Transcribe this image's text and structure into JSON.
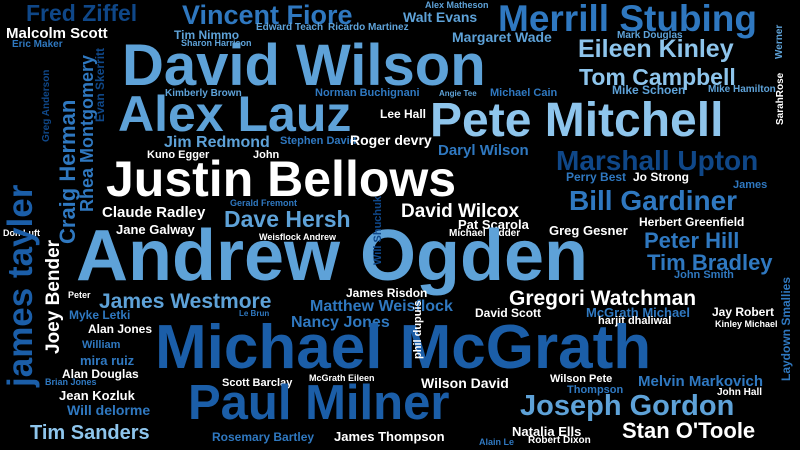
{
  "palette": {
    "background": "#000000",
    "white": "#ffffff",
    "sky": "#8ec5ec",
    "light": "#5ea2d8",
    "mid": "#2f78c0",
    "blue": "#1b5ea8",
    "deep": "#0f4788"
  },
  "words": [
    {
      "text": "Fred Ziffel",
      "color": "deep"
    },
    {
      "text": "Vincent Fiore",
      "color": "mid"
    },
    {
      "text": "Alex Matheson",
      "color": "light"
    },
    {
      "text": "Walt Evans",
      "color": "light"
    },
    {
      "text": "Merrill Stubing",
      "color": "mid"
    },
    {
      "text": "Malcolm Scott",
      "color": "white"
    },
    {
      "text": "Tim Nimmo",
      "color": "light"
    },
    {
      "text": "Edward Teach",
      "color": "light"
    },
    {
      "text": "Ricardo Martinez",
      "color": "light"
    },
    {
      "text": "Margaret Wade",
      "color": "light"
    },
    {
      "text": "Mark Douglas",
      "color": "light"
    },
    {
      "text": "Eric Maker",
      "color": "mid"
    },
    {
      "text": "Sharon Harrison",
      "color": "light"
    },
    {
      "text": "David Wilson",
      "color": "light"
    },
    {
      "text": "Eileen Kinley",
      "color": "sky"
    },
    {
      "text": "Werner",
      "color": "light"
    },
    {
      "text": "Tom Campbell",
      "color": "sky"
    },
    {
      "text": "SarahRose",
      "color": "white"
    },
    {
      "text": "Kimberly Brown",
      "color": "light"
    },
    {
      "text": "Norman Buchignani",
      "color": "mid"
    },
    {
      "text": "Angie Tee",
      "color": "light"
    },
    {
      "text": "Michael Cain",
      "color": "mid"
    },
    {
      "text": "Mike Schoen",
      "color": "light"
    },
    {
      "text": "Mike Hamilton",
      "color": "light"
    },
    {
      "text": "Alex Lauz",
      "color": "light"
    },
    {
      "text": "Lee Hall",
      "color": "white"
    },
    {
      "text": "Pete Mitchell",
      "color": "sky"
    },
    {
      "text": "Jim Redmond",
      "color": "light"
    },
    {
      "text": "Stephen David",
      "color": "mid"
    },
    {
      "text": "Roger devry",
      "color": "white"
    },
    {
      "text": "Daryl Wilson",
      "color": "mid"
    },
    {
      "text": "Kuno Egger",
      "color": "white"
    },
    {
      "text": "John",
      "color": "white"
    },
    {
      "text": "Marshall Upton",
      "color": "deep"
    },
    {
      "text": "Justin Bellows",
      "color": "white"
    },
    {
      "text": "Perry Best",
      "color": "mid"
    },
    {
      "text": "Jo Strong",
      "color": "white"
    },
    {
      "text": "James",
      "color": "mid"
    },
    {
      "text": "Gerald Fremont",
      "color": "mid"
    },
    {
      "text": "Bill Gardiner",
      "color": "mid"
    },
    {
      "text": "Claude Radley",
      "color": "white"
    },
    {
      "text": "Dave Hersh",
      "color": "light"
    },
    {
      "text": "David Wilcox",
      "color": "white"
    },
    {
      "text": "Pat Scarola",
      "color": "white"
    },
    {
      "text": "Herbert Greenfield",
      "color": "white"
    },
    {
      "text": "Jane Galway",
      "color": "white"
    },
    {
      "text": "Weisflock Andrew",
      "color": "white"
    },
    {
      "text": "Michael Kidder",
      "color": "white"
    },
    {
      "text": "Greg Gesner",
      "color": "white"
    },
    {
      "text": "Peter Hill",
      "color": "mid"
    },
    {
      "text": "Don Luft",
      "color": "white"
    },
    {
      "text": "Andrew Ogden",
      "color": "light"
    },
    {
      "text": "Tim Bradley",
      "color": "mid"
    },
    {
      "text": "John Smith",
      "color": "mid"
    },
    {
      "text": "Peter",
      "color": "white"
    },
    {
      "text": "James Risdon",
      "color": "white"
    },
    {
      "text": "James Westmore",
      "color": "light"
    },
    {
      "text": "Gregori Watchman",
      "color": "white"
    },
    {
      "text": "Matthew Weisflock",
      "color": "mid"
    },
    {
      "text": "Myke Letki",
      "color": "mid"
    },
    {
      "text": "Le Brun",
      "color": "mid"
    },
    {
      "text": "David Scott",
      "color": "white"
    },
    {
      "text": "McGrath Michael",
      "color": "mid"
    },
    {
      "text": "Jay Robert",
      "color": "white"
    },
    {
      "text": "Nancy Jones",
      "color": "mid"
    },
    {
      "text": "harjit dhaliwal",
      "color": "white"
    },
    {
      "text": "Kinley Michael",
      "color": "white"
    },
    {
      "text": "Alan Jones",
      "color": "white"
    },
    {
      "text": "Michael McGrath",
      "color": "blue"
    },
    {
      "text": "William",
      "color": "mid"
    },
    {
      "text": "mira ruiz",
      "color": "mid"
    },
    {
      "text": "Alan Douglas",
      "color": "white"
    },
    {
      "text": "Brian Jones",
      "color": "mid"
    },
    {
      "text": "Scott Barclay",
      "color": "white"
    },
    {
      "text": "McGrath Eileen",
      "color": "white"
    },
    {
      "text": "Wilson David",
      "color": "white"
    },
    {
      "text": "Wilson Pete",
      "color": "white"
    },
    {
      "text": "Melvin Markovich",
      "color": "mid"
    },
    {
      "text": "Thompson",
      "color": "mid"
    },
    {
      "text": "John Hall",
      "color": "white"
    },
    {
      "text": "Jean Kozluk",
      "color": "white"
    },
    {
      "text": "Will delorme",
      "color": "mid"
    },
    {
      "text": "Paul Milner",
      "color": "blue"
    },
    {
      "text": "Joseph Gordon",
      "color": "light"
    },
    {
      "text": "Tim Sanders",
      "color": "sky"
    },
    {
      "text": "Rosemary Bartley",
      "color": "mid"
    },
    {
      "text": "James Thompson",
      "color": "white"
    },
    {
      "text": "Alain Le",
      "color": "mid"
    },
    {
      "text": "Natalia Ells",
      "color": "white"
    },
    {
      "text": "Robert Dixon",
      "color": "white"
    },
    {
      "text": "Stan O'Toole",
      "color": "white"
    },
    {
      "text": "james tayler",
      "color": "blue"
    },
    {
      "text": "Craig Herman",
      "color": "mid"
    },
    {
      "text": "Rhea Montgomery",
      "color": "mid"
    },
    {
      "text": "Evan Skerritt",
      "color": "deep"
    },
    {
      "text": "Greg Anderson",
      "color": "deep"
    },
    {
      "text": "Joey Bender",
      "color": "white"
    },
    {
      "text": "Will Shuchuk",
      "color": "deep"
    },
    {
      "text": "phil dupuis",
      "color": "white"
    },
    {
      "text": "Laydown Smallies",
      "color": "mid"
    }
  ]
}
